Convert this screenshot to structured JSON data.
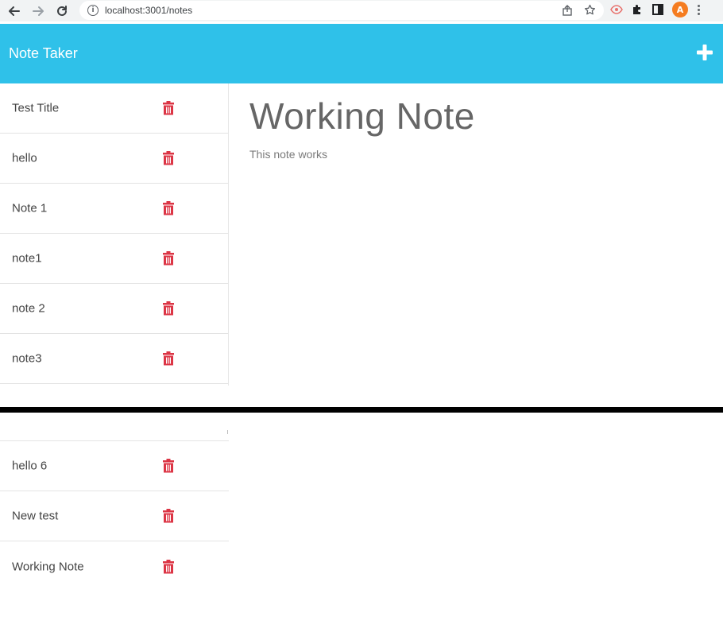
{
  "browser": {
    "url": "localhost:3001/notes",
    "avatar_letter": "A"
  },
  "app": {
    "brand": "Note Taker"
  },
  "notes_top": [
    {
      "title": "Test Title"
    },
    {
      "title": "hello"
    },
    {
      "title": "Note 1"
    },
    {
      "title": "note1"
    },
    {
      "title": "note 2"
    },
    {
      "title": "note3"
    }
  ],
  "notes_bottom": [
    {
      "title": "hello 6"
    },
    {
      "title": "New test"
    },
    {
      "title": "Working Note"
    }
  ],
  "active_note": {
    "title": "Working Note",
    "text": "This note works"
  },
  "colors": {
    "navbar": "#2fc1e9",
    "delete_icon": "#dc3545",
    "avatar": "#f57c20"
  },
  "icons": {
    "delete": "trash-icon",
    "new_note": "plus-icon"
  }
}
